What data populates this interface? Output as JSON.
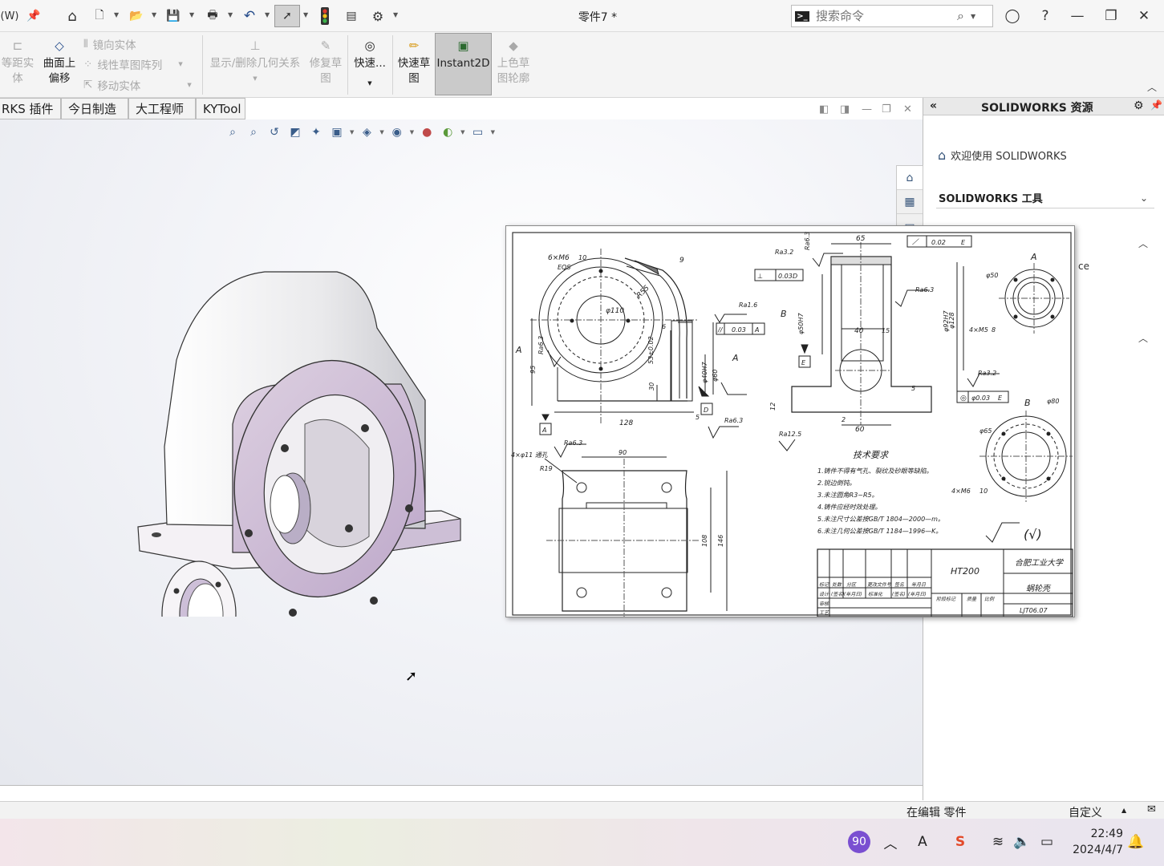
{
  "titlebar": {
    "left_fragment": "(W)",
    "doc_title": "零件7 *",
    "search_placeholder": "搜索命令",
    "prompt_symbol": ">_"
  },
  "ribbon": {
    "offset_entities": "等距实\n体",
    "surface_offset": "曲面上\n偏移",
    "mirror_entities": "镜向实体",
    "linear_pattern": "线性草图阵列",
    "move_entities": "移动实体",
    "display_relations": "显示/删除几何关系",
    "repair_sketch": "修复草\n图",
    "quick_snaps": "快速...",
    "rapid_sketch": "快速草\n图",
    "instant2d": "Instant2D",
    "shaded_contours": "上色草\n图轮廓"
  },
  "tabs": [
    {
      "label": "RKS 插件"
    },
    {
      "label": "今日制造"
    },
    {
      "label": "大工程师"
    },
    {
      "label": "KYTool"
    }
  ],
  "task_pane": {
    "title": "SOLIDWORKS 资源",
    "welcome": "欢迎使用  SOLIDWORKS",
    "tools_section": "SOLIDWORKS 工具",
    "truncated_text": "ce"
  },
  "drawing": {
    "dims": {
      "d65": "65",
      "tol002": "0.02",
      "datumE": "E",
      "ra32a": "Ra3.2",
      "ra63a": "Ra6.3",
      "flat003": "0.03",
      "datumD": "D",
      "datumB": "B",
      "ra16": "Ra1.6",
      "par003": "0.03",
      "datumA": "A",
      "phi50h7": "φ50H7",
      "phi92h7": "φ92H7",
      "phi128": "φ128",
      "d40": "40",
      "d15": "15",
      "ra63b": "Ra6.3",
      "thread": "6×M6",
      "thread_depth": "10",
      "eqs": "EQS",
      "d9": "9",
      "r55": "R55",
      "phi110": "φ110",
      "d6": "6",
      "d53": "53±0.02",
      "phi40h7": "φ40H7",
      "phi60": "φ60",
      "ra63c": "Ra6.3",
      "d95": "95",
      "d30": "30",
      "d128": "128",
      "d5a": "5",
      "d12": "12",
      "d60": "60",
      "d2": "2",
      "d5b": "5",
      "ra125": "Ra12.5",
      "ra32b": "Ra3.2",
      "conc003": "φ0.03",
      "viewA": "A",
      "phi50": "φ50",
      "m5": "4×M5",
      "m5_depth": "8",
      "viewB": "B",
      "phi80": "φ80",
      "phi65": "φ65",
      "m6": "4×M6",
      "m6_depth": "10",
      "holes": "4×φ11 通孔",
      "r19": "R19",
      "ra63d": "Ra6.3",
      "d90": "90",
      "d108": "108",
      "d146": "146"
    },
    "tech_title": "技术要求",
    "tech_notes": [
      "1.铸件不得有气孔、裂纹及砂眼等缺陷。",
      "2.锐边倒钝。",
      "3.未注圆角R3~R5。",
      "4.铸件应经时效处理。",
      "5.未注尺寸公差按GB/T 1804—2000—m。",
      "6.未注几何公差按GB/T 1184—1996—K。"
    ],
    "roughness_note": "(√)",
    "title_block": {
      "material": "HT200",
      "school": "合肥工业大学",
      "part_name": "蜗轮壳",
      "drawing_no": "LJT06.07",
      "row1": [
        "标记",
        "处数",
        "分区",
        "更改文件号",
        "签名",
        "年月日"
      ],
      "row2": [
        "设计",
        "(签名)",
        "(年月日)",
        "标准化",
        "(签名)",
        "(年月日)"
      ],
      "stage": "阶段标记",
      "weight": "质量",
      "scale": "比例",
      "check": "审核",
      "approve": "工艺"
    }
  },
  "statusbar": {
    "editing": "在编辑 零件",
    "units": "自定义"
  },
  "taskbar": {
    "badge": "90",
    "time": "22:49",
    "date": "2024/4/7",
    "badge_color": "#7a4fd1"
  }
}
